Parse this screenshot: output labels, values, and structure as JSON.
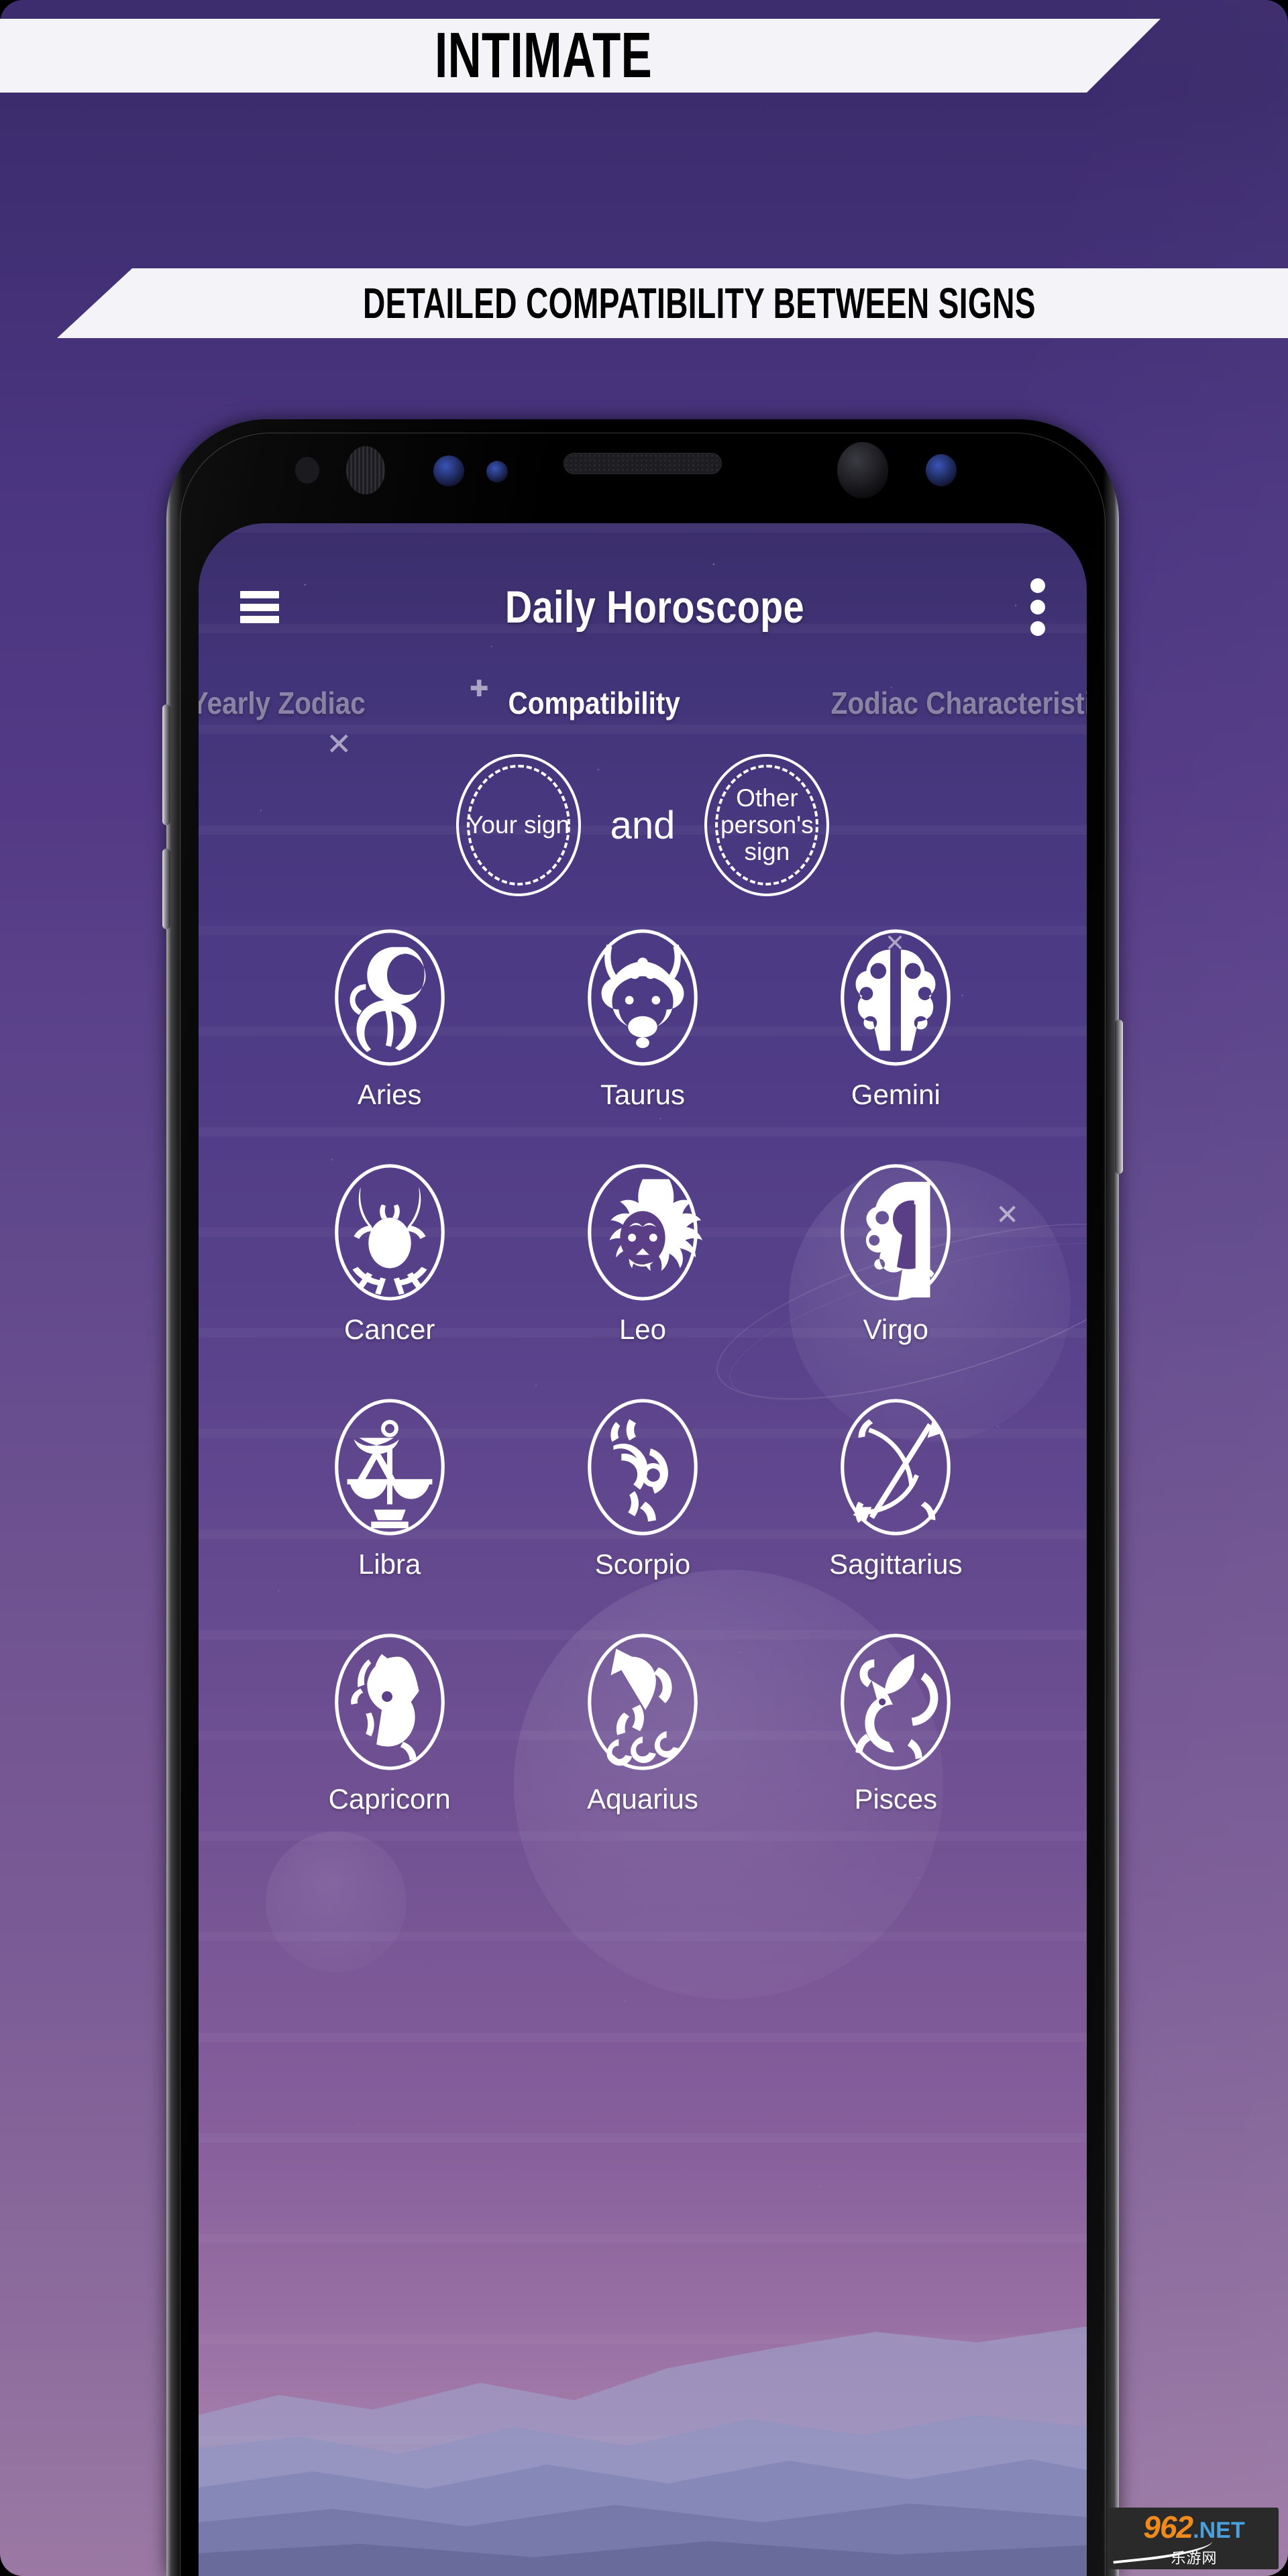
{
  "promo": {
    "headline": "INTIMATE",
    "subhead": "DETAILED COMPATIBILITY BETWEEN SIGNS",
    "bg_top_color": "#3d2d6e",
    "bg_bottom_color": "#9b79a4",
    "banner_color": "#f4f3f8"
  },
  "app": {
    "title": "Daily Horoscope",
    "menu_icon": "hamburger-icon",
    "overflow_icon": "kebab-menu-icon",
    "tabs": [
      {
        "label": "Yearly Zodiac",
        "active": false
      },
      {
        "label": "Compatibility",
        "active": true
      },
      {
        "label": "Zodiac Characteristics",
        "active": false
      }
    ],
    "selector": {
      "your_sign_label": "Your sign",
      "conjunction": "and",
      "other_sign_label": "Other person's sign"
    },
    "signs": [
      {
        "name": "Aries",
        "icon": "aries-icon"
      },
      {
        "name": "Taurus",
        "icon": "taurus-icon"
      },
      {
        "name": "Gemini",
        "icon": "gemini-icon"
      },
      {
        "name": "Cancer",
        "icon": "cancer-icon"
      },
      {
        "name": "Leo",
        "icon": "leo-icon"
      },
      {
        "name": "Virgo",
        "icon": "virgo-icon"
      },
      {
        "name": "Libra",
        "icon": "libra-icon"
      },
      {
        "name": "Scorpio",
        "icon": "scorpio-icon"
      },
      {
        "name": "Sagittarius",
        "icon": "sagittarius-icon"
      },
      {
        "name": "Capricorn",
        "icon": "capricorn-icon"
      },
      {
        "name": "Aquarius",
        "icon": "aquarius-icon"
      },
      {
        "name": "Pisces",
        "icon": "pisces-icon"
      }
    ],
    "accent_color": "#4c3a84",
    "text_color": "#ffffff"
  },
  "watermark": {
    "number": "962",
    "tld": ".NET",
    "chinese": "乐游网"
  }
}
